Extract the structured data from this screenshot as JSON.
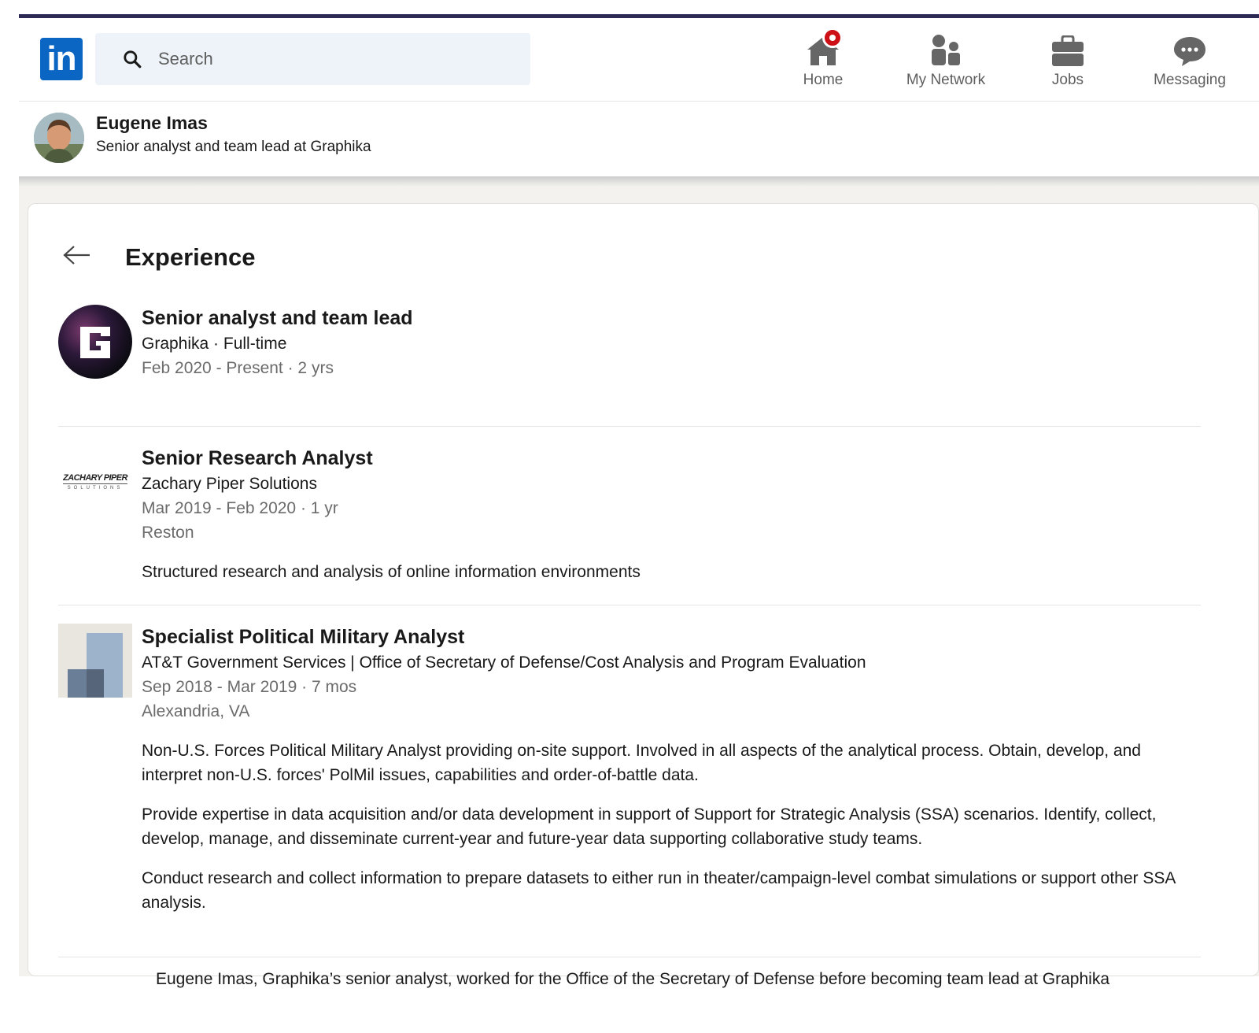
{
  "nav": {
    "search_placeholder": "Search",
    "items": [
      {
        "label": "Home",
        "icon": "home-icon",
        "has_notification": true
      },
      {
        "label": "My Network",
        "icon": "network-icon"
      },
      {
        "label": "Jobs",
        "icon": "briefcase-icon"
      },
      {
        "label": "Messaging",
        "icon": "messaging-icon"
      }
    ]
  },
  "profile": {
    "name": "Eugene Imas",
    "headline": "Senior analyst and team lead at Graphika"
  },
  "section": {
    "title": "Experience"
  },
  "experiences": [
    {
      "title": "Senior analyst and team lead",
      "company": "Graphika · Full-time",
      "dates": "Feb 2020 - Present · 2 yrs",
      "logo": "graphika-logo"
    },
    {
      "title": "Senior Research Analyst",
      "company": "Zachary Piper Solutions",
      "dates": "Mar 2019 - Feb 2020 · 1 yr",
      "location": "Reston",
      "description": "Structured research and analysis of online information environments",
      "logo": "zachary-piper-logo",
      "logo_text": "ZACHARY PIPER",
      "logo_subtext": "SOLUTIONS"
    },
    {
      "title": "Specialist Political Military Analyst",
      "company": "AT&T Government Services | Office of Secretary of Defense/Cost Analysis and Program Evaluation",
      "dates": "Sep 2018 - Mar 2019 · 7 mos",
      "location": "Alexandria, VA",
      "description_paragraphs": [
        "Non-U.S. Forces Political Military Analyst providing on-site support. Involved in all aspects of the analytical process. Obtain, develop, and interpret non-U.S. forces' PolMil issues, capabilities and order-of-battle data.",
        "Provide expertise in data acquisition and/or data development in support of Support for Strategic Analysis (SSA) scenarios. Identify, collect, develop, manage, and disseminate current-year and future-year data supporting collaborative study teams.",
        "Conduct research and collect information to prepare datasets to either run in theater/campaign-level combat simulations or support other SSA analysis."
      ],
      "logo": "company-placeholder-logo"
    }
  ],
  "caption": "Eugene Imas, Graphika’s senior analyst, worked for the Office of the Secretary of Defense before becoming team lead at Graphika",
  "colors": {
    "brand": "#0a66c2",
    "notification": "#cc1016",
    "background": "#f3f2ef"
  }
}
